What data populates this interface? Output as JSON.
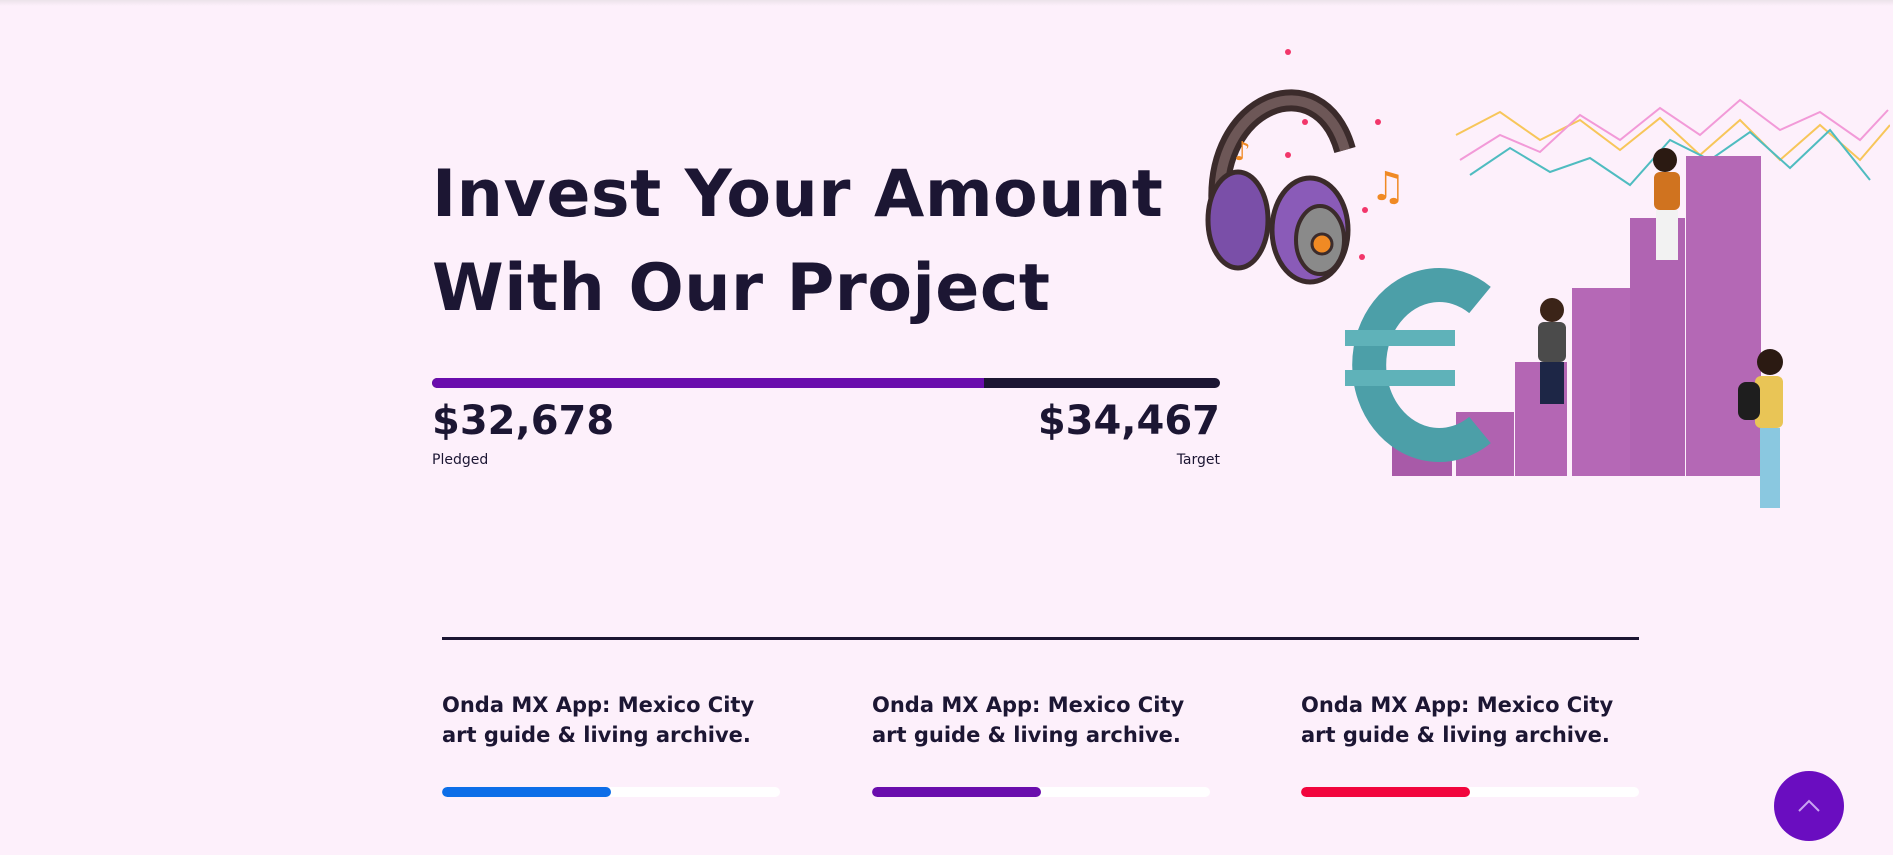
{
  "hero": {
    "title_line1": "Invest Your Amount",
    "title_line2": "With Our Project",
    "progress": {
      "percent": 70,
      "fill_color": "#6a0dad",
      "track_color": "#1c1633"
    },
    "pledged": {
      "amount": "$32,678",
      "label": "Pledged"
    },
    "target": {
      "amount": "$34,467",
      "label": "Target"
    }
  },
  "illustration": {
    "icons": [
      "headphones-icon",
      "music-note-icon",
      "euro-icon",
      "bar-chart-icon",
      "line-chart-icon"
    ]
  },
  "projects": [
    {
      "title": "Onda MX App: Mexico City art guide & living archive.",
      "progress_percent": 50,
      "color": "#0d6ee8"
    },
    {
      "title": "Onda MX App: Mexico City art guide & living archive.",
      "progress_percent": 50,
      "color": "#6a0dad"
    },
    {
      "title": "Onda MX App: Mexico City art guide & living archive.",
      "progress_percent": 50,
      "color": "#f2053d"
    }
  ],
  "scroll_top": {
    "icon": "chevron-up-icon",
    "color": "#6a0dc0"
  }
}
